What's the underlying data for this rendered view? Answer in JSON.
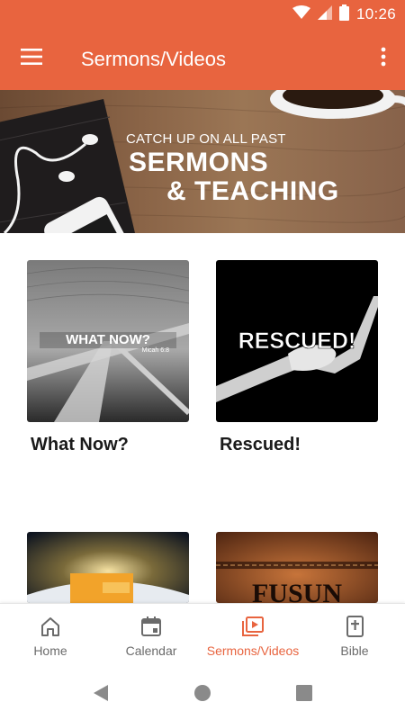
{
  "status": {
    "time": "10:26",
    "icons": [
      "wifi-icon",
      "signal-icon",
      "battery-icon"
    ]
  },
  "app_bar": {
    "title": "Sermons/Videos",
    "menu_icon": "hamburger-icon",
    "overflow_icon": "more-vert-icon",
    "color": "#e8643f"
  },
  "banner": {
    "line1": "CATCH UP ON ALL PAST",
    "line2": "SERMONS",
    "line3": "& TEACHING"
  },
  "cards": [
    {
      "title": "What Now?",
      "thumb_text": "WHAT NOW?",
      "thumb_subtext": "Micah 6:8"
    },
    {
      "title": "Rescued!",
      "thumb_text": "RESCUED!"
    },
    {
      "title": "",
      "thumb_text": ""
    },
    {
      "title": "",
      "thumb_text": "FUSUN"
    }
  ],
  "bottom_nav": {
    "items": [
      {
        "label": "Home",
        "icon": "home-icon",
        "active": false
      },
      {
        "label": "Calendar",
        "icon": "calendar-icon",
        "active": false
      },
      {
        "label": "Sermons/Videos",
        "icon": "video-library-icon",
        "active": true
      },
      {
        "label": "Bible",
        "icon": "bible-icon",
        "active": false
      }
    ],
    "active_color": "#e8643f"
  },
  "system_nav": {
    "icons": [
      "back-icon",
      "home-circle-icon",
      "recents-icon"
    ]
  }
}
